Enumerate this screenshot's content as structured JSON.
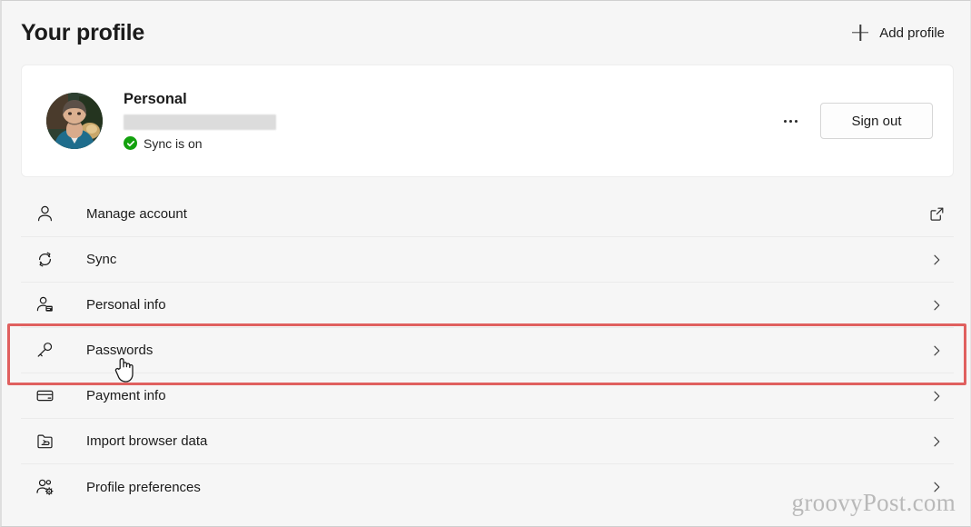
{
  "header": {
    "title": "Your profile",
    "add_profile_label": "Add profile",
    "add_profile_icon": "plus-icon"
  },
  "profile_card": {
    "avatar_icon": "avatar-photo",
    "name": "Personal",
    "email_redacted": "",
    "sync_status": "Sync is on",
    "sync_status_icon": "check-circle-icon",
    "sync_status_color": "#13a10e",
    "more_button_icon": "ellipsis-icon",
    "sign_out_label": "Sign out"
  },
  "settings_list": {
    "items": [
      {
        "label": "Manage account",
        "icon": "person-icon",
        "trailing_icon": "external-link-icon"
      },
      {
        "label": "Sync",
        "icon": "sync-arrows-icon",
        "trailing_icon": "chevron-right-icon"
      },
      {
        "label": "Personal info",
        "icon": "person-card-icon",
        "trailing_icon": "chevron-right-icon"
      },
      {
        "label": "Passwords",
        "icon": "key-icon",
        "trailing_icon": "chevron-right-icon"
      },
      {
        "label": "Payment info",
        "icon": "credit-card-icon",
        "trailing_icon": "chevron-right-icon"
      },
      {
        "label": "Import browser data",
        "icon": "import-folder-icon",
        "trailing_icon": "chevron-right-icon"
      },
      {
        "label": "Profile preferences",
        "icon": "people-gear-icon",
        "trailing_icon": "chevron-right-icon"
      }
    ]
  },
  "annotation": {
    "highlight_target": "Passwords",
    "highlight_color": "#e0605f"
  },
  "cursor": {
    "icon": "hand-pointer-cursor",
    "over": "Passwords"
  },
  "watermark": {
    "text": "groovyPost.com"
  },
  "colors": {
    "page_background": "#f6f6f6",
    "card_background": "#ffffff",
    "text_primary": "#1b1b1b",
    "divider": "#ebebeb",
    "accent_green": "#13a10e",
    "annotation_red": "#e0605f"
  }
}
